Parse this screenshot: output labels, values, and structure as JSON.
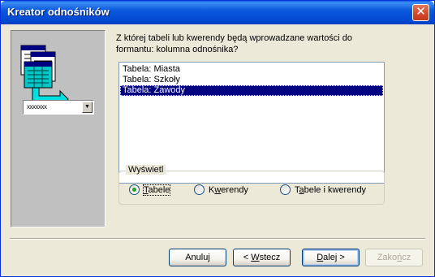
{
  "window": {
    "title": "Kreator odnośników",
    "close_glyph": "✕"
  },
  "illustration": {
    "icon": "tables-to-combo-illustration-icon",
    "combo_text": "xxxxxxx",
    "combo_arrow": "▼"
  },
  "prompt": {
    "text": "Z której tabeli lub kwerendy będą wprowadzane wartości do formantu: kolumna odnośnika?"
  },
  "list": {
    "items": [
      {
        "label": "Tabela: Miasta",
        "selected": false
      },
      {
        "label": "Tabela: Szkoły",
        "selected": false
      },
      {
        "label": "Tabela: Zawody",
        "selected": true
      }
    ]
  },
  "view_group": {
    "legend": "Wyświetl",
    "options": [
      {
        "label_pre": "",
        "label_mnemonic": "T",
        "label_post": "abele",
        "checked": true
      },
      {
        "label_pre": "K",
        "label_mnemonic": "w",
        "label_post": "erendy",
        "checked": false
      },
      {
        "label_pre": "T",
        "label_mnemonic": "a",
        "label_post": "bele i kwerendy",
        "checked": false
      }
    ]
  },
  "buttons": {
    "cancel": "Anuluj",
    "back_pre": "< ",
    "back_mnemonic": "W",
    "back_post": "stecz",
    "next_pre": "",
    "next_mnemonic": "D",
    "next_post": "alej >",
    "finish_pre": "Zako",
    "finish_mnemonic": "ń",
    "finish_post": "cz"
  },
  "colors": {
    "titlebar": "#0054e3",
    "selection": "#000080",
    "radio_dot": "#21a121",
    "panel": "#c0c0c0"
  }
}
